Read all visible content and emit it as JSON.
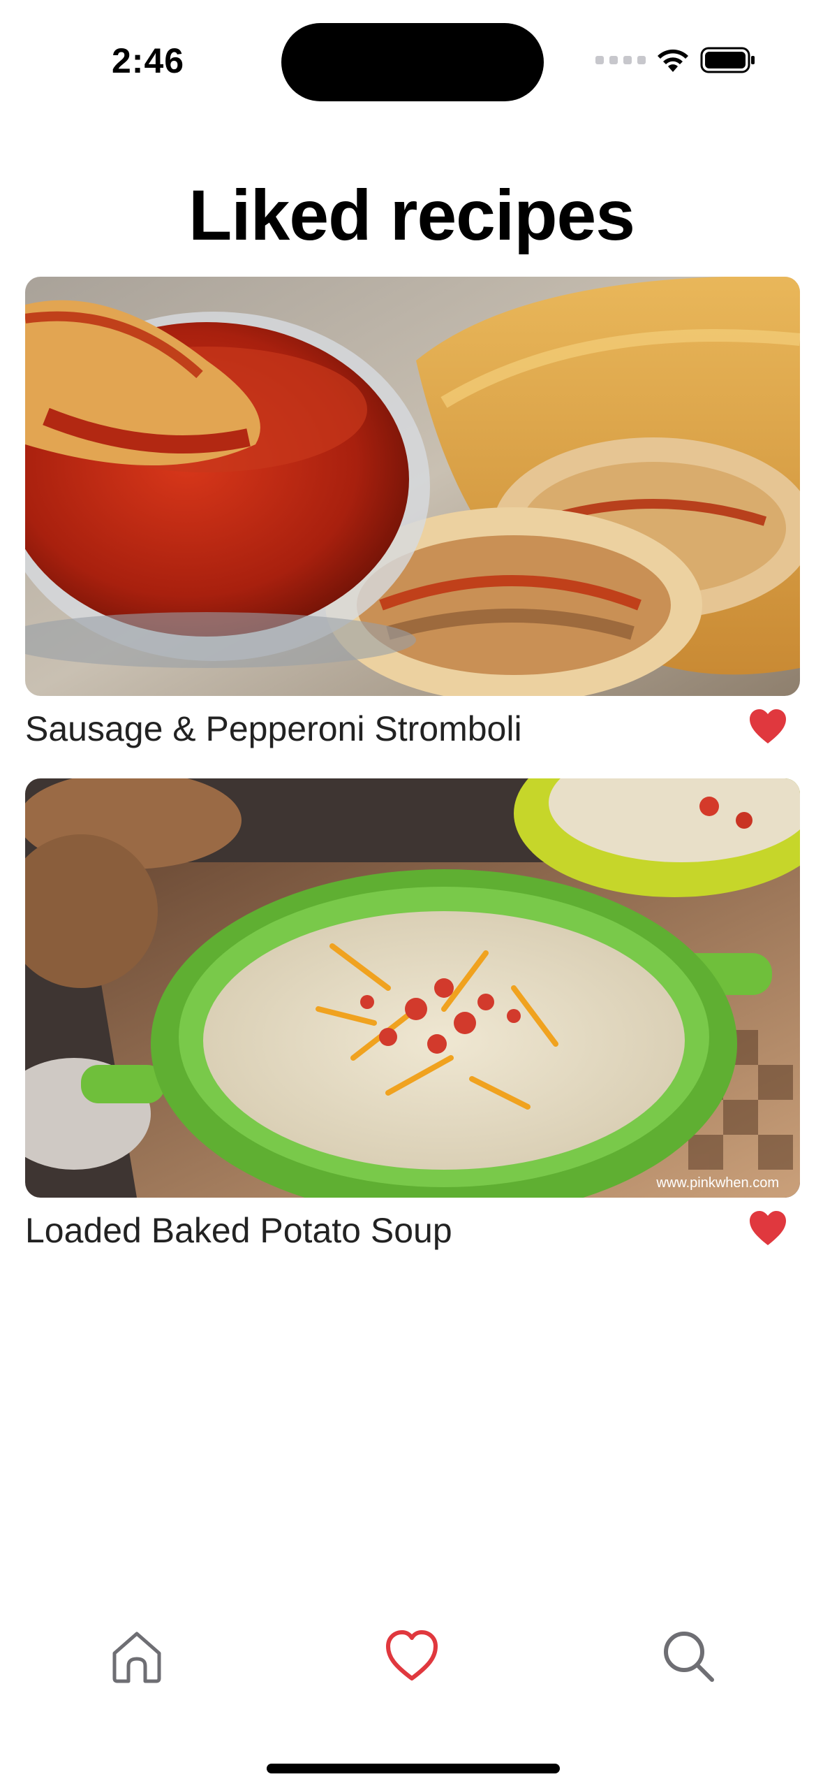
{
  "status_bar": {
    "time": "2:46"
  },
  "page": {
    "title": "Liked recipes"
  },
  "recipes": [
    {
      "name": "Sausage & Pepperoni Stromboli",
      "liked": true,
      "image_icon": "stromboli-photo"
    },
    {
      "name": "Loaded Baked Potato Soup",
      "liked": true,
      "image_icon": "potato-soup-photo",
      "watermark": "www.pinkwhen.com"
    }
  ],
  "tab_bar": {
    "tabs": [
      {
        "name": "home",
        "icon": "home-icon",
        "active": false
      },
      {
        "name": "liked",
        "icon": "heart-icon",
        "active": true
      },
      {
        "name": "search",
        "icon": "search-icon",
        "active": false
      }
    ]
  },
  "colors": {
    "accent": "#e0383e",
    "inactive_icon": "#6e6e73",
    "text": "#222222"
  }
}
